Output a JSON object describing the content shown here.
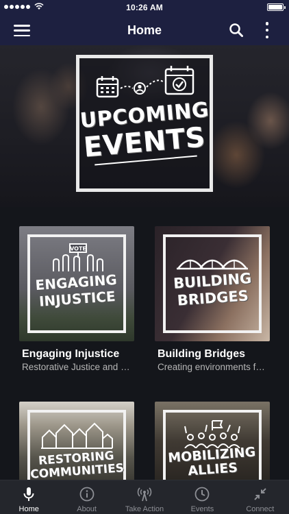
{
  "status_bar": {
    "time": "10:26 AM"
  },
  "header": {
    "title": "Home"
  },
  "hero": {
    "line1": "UPCOMING",
    "line2": "EVENTS",
    "page_count": 2,
    "active_page": 0
  },
  "cards": [
    {
      "graphic_title": "ENGAGING INJUSTICE",
      "graphic_sign": "VOTE",
      "title": "Engaging Injustice",
      "subtitle": "Restorative Justice and Racial Reconciliation"
    },
    {
      "graphic_title": "BUILDING BRIDGES",
      "title": "Building Bridges",
      "subtitle": "Creating environments for dialogue"
    },
    {
      "graphic_title": "RESTORING COMMUNITIES",
      "title": "",
      "subtitle": ""
    },
    {
      "graphic_title": "MOBILIZING ALLIES",
      "title": "",
      "subtitle": ""
    }
  ],
  "tabs": [
    {
      "label": "Home",
      "icon": "microphone-icon",
      "active": true
    },
    {
      "label": "About",
      "icon": "info-icon",
      "active": false
    },
    {
      "label": "Take Action",
      "icon": "broadcast-icon",
      "active": false
    },
    {
      "label": "Events",
      "icon": "clock-icon",
      "active": false
    },
    {
      "label": "Connect",
      "icon": "connect-arrows-icon",
      "active": false
    }
  ],
  "colors": {
    "nav_bg": "#1d2040",
    "page_bg": "#14161b",
    "tab_bar_bg": "#24262c",
    "tab_inactive": "#8d8f95",
    "tab_active": "#ffffff"
  }
}
